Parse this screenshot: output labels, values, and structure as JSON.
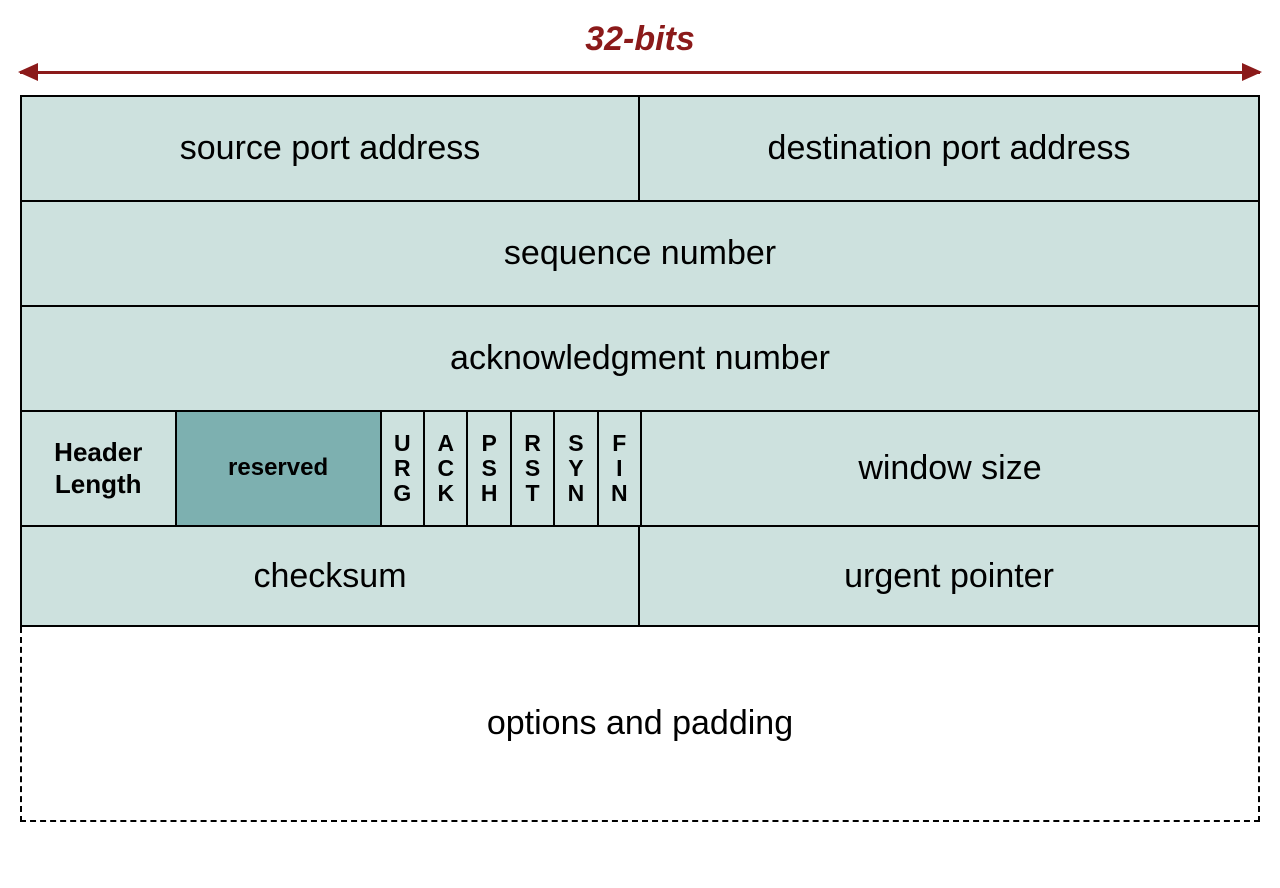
{
  "diagram": {
    "bits_label": "32-bits",
    "row1": {
      "src_port": "source port address",
      "dst_port": "destination port address"
    },
    "row2": {
      "seq": "sequence number"
    },
    "row3": {
      "ack": "acknowledgment number"
    },
    "row4": {
      "header_len": "Header Length",
      "reserved": "reserved",
      "flags": [
        "URG",
        "ACK",
        "PSH",
        "RST",
        "SYN",
        "FIN"
      ],
      "window": "window size"
    },
    "row5": {
      "checksum": "checksum",
      "urgent": "urgent pointer"
    },
    "row6": {
      "options": "options and padding"
    }
  }
}
